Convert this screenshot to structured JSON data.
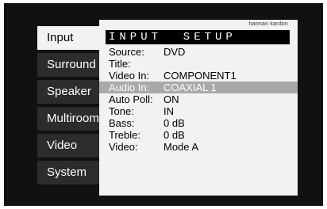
{
  "menu": {
    "items": [
      {
        "label": "Input",
        "active": true
      },
      {
        "label": "Surround",
        "active": false
      },
      {
        "label": "Speaker",
        "active": false
      },
      {
        "label": "Multiroom",
        "active": false
      },
      {
        "label": "Video",
        "active": false
      },
      {
        "label": "System",
        "active": false
      }
    ]
  },
  "panel": {
    "brand": "harman kardon",
    "title": "INPUT  SETUP",
    "rows": [
      {
        "label": "Source:",
        "value": "DVD"
      },
      {
        "label": "Title:",
        "value": ""
      },
      {
        "label": "Video In:",
        "value": "COMPONENT1"
      },
      {
        "label": "Audio In:",
        "value": "COAXIAL 1",
        "highlighted": true
      },
      {
        "label": "Auto Poll:",
        "value": "ON"
      },
      {
        "label": "Tone:",
        "value": "IN"
      },
      {
        "label": "Bass:",
        "value": "0 dB"
      },
      {
        "label": "Treble:",
        "value": "0 dB"
      },
      {
        "label": "Video:",
        "value": "Mode A"
      }
    ]
  },
  "colors": {
    "screen_bg": "#111111",
    "menu_bg": "#2c2c2c",
    "panel_bg": "#f2f2f2",
    "highlight_bg": "#a9a9a9",
    "title_bg": "#000000"
  }
}
